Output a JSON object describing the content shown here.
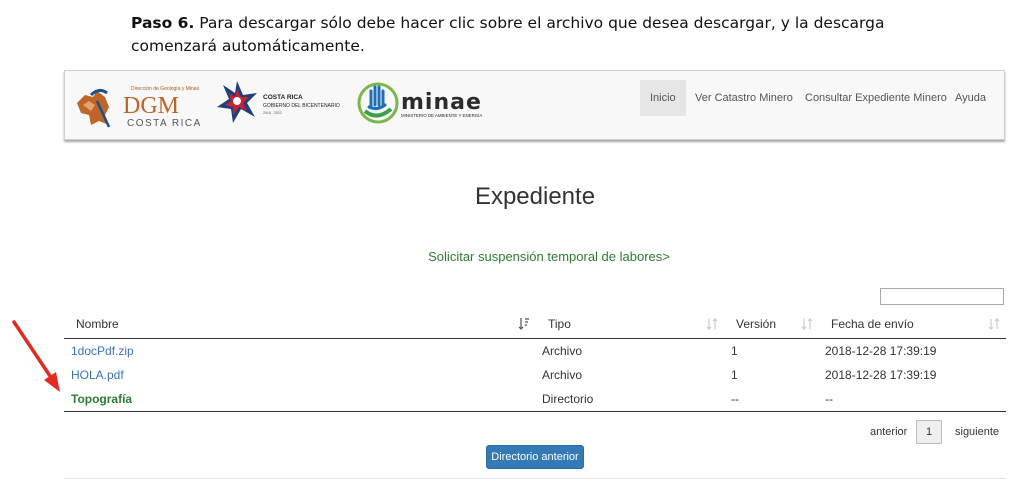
{
  "instructions": {
    "step_label": "Paso 6.",
    "text_line1": " Para descargar sólo debe hacer clic sobre el archivo que desea descargar, y la descarga",
    "text_line2": "comenzará automáticamente."
  },
  "header": {
    "logos": {
      "dgm_top": "Dirección de Geología y Minas",
      "dgm_main": "DGM",
      "dgm_sub": "COSTA RICA",
      "cr_line1": "COSTA RICA",
      "cr_line2": "GOBIERNO DEL BICENTENARIO",
      "cr_line3": "2018 - 2022",
      "minae_main": "minae",
      "minae_sub": "MINISTERIO DE AMBIENTE Y ENERGÍA"
    },
    "nav": [
      {
        "label": "Inicio",
        "active": true
      },
      {
        "label": "Ver Catastro Minero",
        "active": false
      },
      {
        "label": "Consultar Expediente Minero",
        "active": false
      },
      {
        "label": "Ayuda",
        "active": false
      }
    ]
  },
  "page": {
    "title": "Expediente",
    "suspension_link": "Solicitar suspensión temporal de labores>"
  },
  "table": {
    "filter_value": "",
    "headers": {
      "nombre": "Nombre",
      "tipo": "Tipo",
      "version": "Versión",
      "fecha": "Fecha de envío"
    },
    "rows": [
      {
        "nombre": "1docPdf.zip",
        "tipo": "Archivo",
        "version": "1",
        "fecha": "2018-12-28 17:39:19",
        "kind": "file"
      },
      {
        "nombre": "HOLA.pdf",
        "tipo": "Archivo",
        "version": "1",
        "fecha": "2018-12-28 17:39:19",
        "kind": "file"
      },
      {
        "nombre": "Topografía",
        "tipo": "Directorio",
        "version": "--",
        "fecha": "--",
        "kind": "directory"
      }
    ]
  },
  "pagination": {
    "prev": "anterior",
    "page": "1",
    "next": "siguiente"
  },
  "actions": {
    "previous_directory": "Directorio anterior"
  },
  "colors": {
    "link_blue": "#3b73b9",
    "directory_green": "#2e7d32",
    "button_blue": "#337ab7",
    "arrow_red": "#e32b22"
  }
}
